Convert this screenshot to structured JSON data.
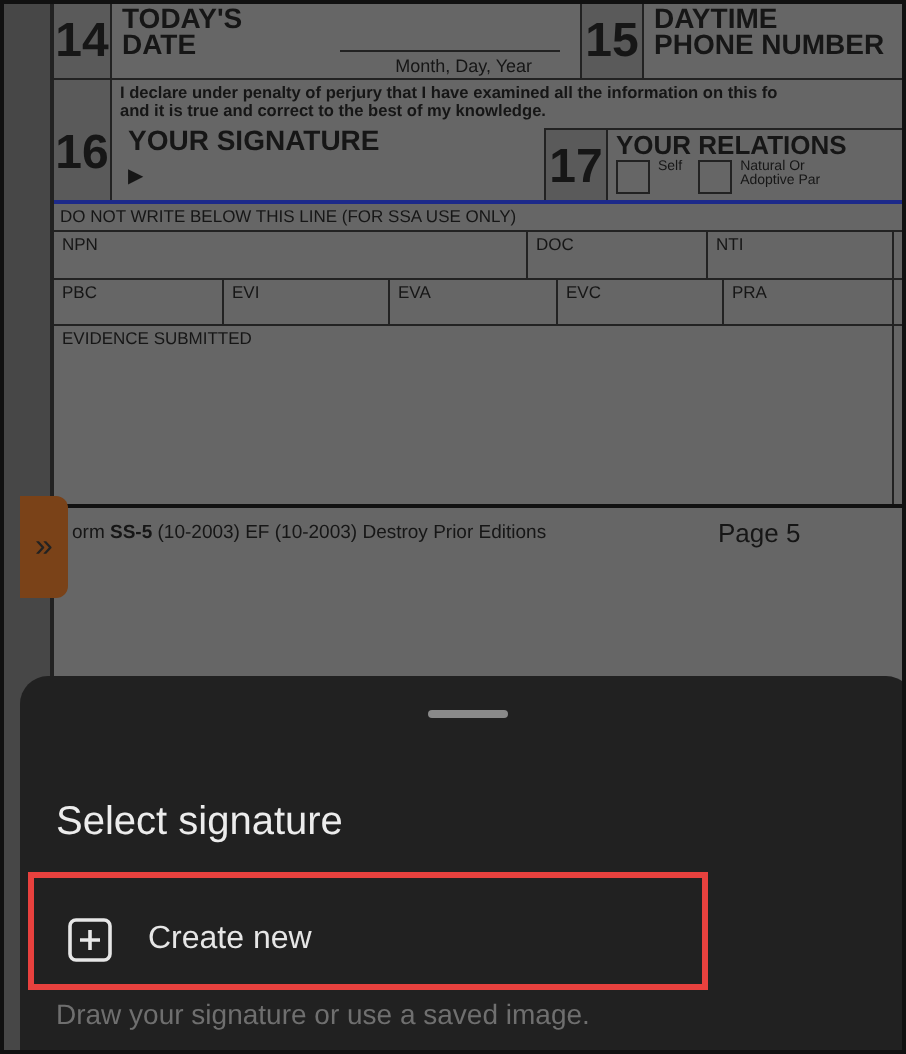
{
  "form": {
    "top_fields": [
      {
        "number": "14",
        "title": [
          "TODAY'S",
          "DATE"
        ],
        "hint": "Month, Day, Year"
      },
      {
        "number": "15",
        "title": [
          "DAYTIME",
          "PHONE NUMBER"
        ]
      }
    ],
    "declaration": [
      "I declare under penalty of perjury that I have examined all the information on this fo",
      "and it is true and correct to the best of my knowledge."
    ],
    "signature": {
      "number": "16",
      "title": "YOUR SIGNATURE",
      "marker": "▶"
    },
    "relationship": {
      "number": "17",
      "title": "YOUR RELATIONS",
      "options": [
        {
          "label": [
            "Self"
          ],
          "checked": false
        },
        {
          "label": [
            "Natural Or",
            "Adoptive Par"
          ],
          "checked": false
        }
      ]
    },
    "ssa": {
      "heading": "DO NOT WRITE BELOW THIS LINE (FOR SSA USE ONLY)",
      "rows": [
        [
          "NPN",
          "DOC",
          "NTI"
        ],
        [
          "PBC",
          "EVI",
          "EVA",
          "EVC",
          "PRA"
        ],
        [
          "EVIDENCE SUBMITTED"
        ]
      ]
    },
    "footer": {
      "edition": "orm **SS-5** (10-2003)   EF (10-2003)   Destroy Prior Editions",
      "page": "Page 5"
    }
  },
  "side_tab": {
    "glyph": "»"
  },
  "sheet": {
    "title": "Select signature",
    "options": [
      {
        "label": "Create new",
        "highlighted": true
      }
    ],
    "description": "Draw your signature or use a saved image."
  }
}
